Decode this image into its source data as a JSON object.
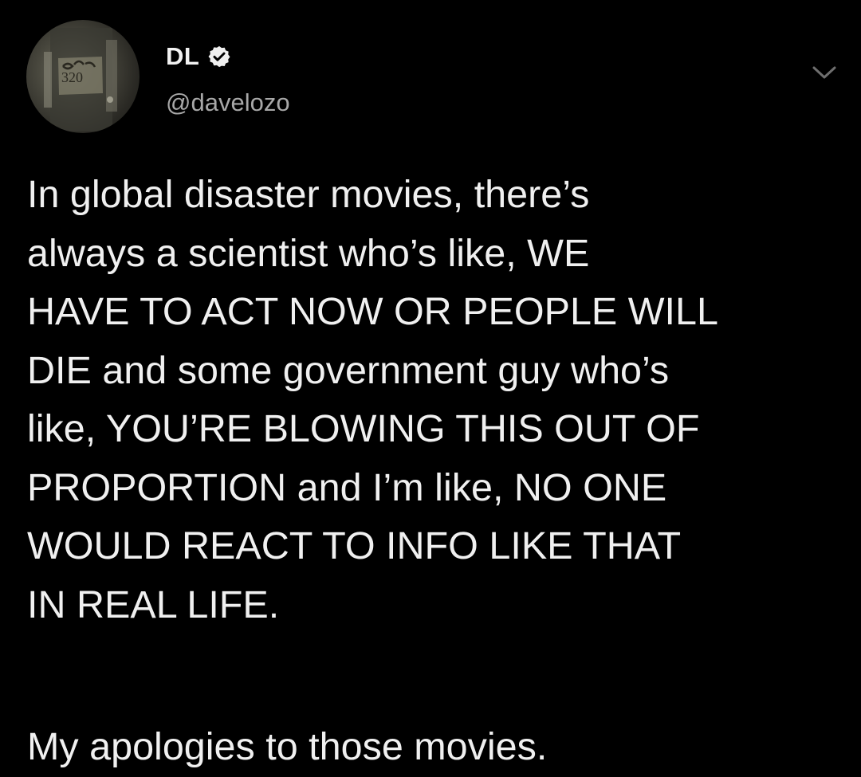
{
  "tweet": {
    "author": {
      "display_name": "DL",
      "handle": "@davelozo",
      "verified_icon": "verified-badge-icon",
      "avatar_mark": "320"
    },
    "menu_icon": "chevron-down-icon",
    "text_lines": [
      "In global disaster movies, there’s",
      "always a scientist who’s like, WE",
      "HAVE TO ACT NOW OR PEOPLE WILL",
      "DIE and some government guy who’s",
      "like, YOU’RE BLOWING THIS OUT OF",
      "PROPORTION and I’m like, NO ONE",
      "WOULD REACT TO INFO LIKE THAT",
      "IN REAL LIFE."
    ],
    "closing_line": "My apologies to those movies."
  },
  "colors": {
    "background": "#000000",
    "text": "#f0f0f0",
    "handle": "#a8a8a8"
  }
}
